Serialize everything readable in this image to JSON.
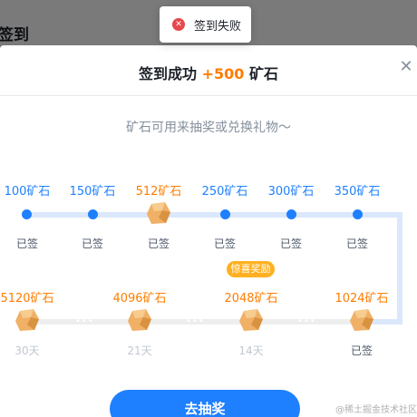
{
  "page": {
    "title": "签到"
  },
  "toast": {
    "icon": "error-icon",
    "text": "签到失败"
  },
  "modal": {
    "title_prefix": "签到成功",
    "title_bonus": "+500",
    "title_suffix": "矿石",
    "close_icon": "close-icon",
    "subtitle": "矿石可用来抽奖或兑换礼物～",
    "row1": [
      {
        "amount": "100矿石",
        "status": "已签",
        "reward": false
      },
      {
        "amount": "150矿石",
        "status": "已签",
        "reward": false
      },
      {
        "amount": "512矿石",
        "status": "已签",
        "reward": true
      },
      {
        "amount": "250矿石",
        "status": "已签",
        "reward": false
      },
      {
        "amount": "300矿石",
        "status": "已签",
        "reward": false
      },
      {
        "amount": "350矿石",
        "status": "已签",
        "reward": false
      }
    ],
    "row2": [
      {
        "amount": "5120矿石",
        "status": "30天",
        "reward": true
      },
      {
        "amount": "4096矿石",
        "status": "21天",
        "reward": true
      },
      {
        "amount": "2048矿石",
        "status": "14天",
        "reward": true,
        "badge": "惊喜奖励"
      },
      {
        "amount": "1024矿石",
        "status": "已签",
        "reward": true
      }
    ],
    "cta_label": "去抽奖"
  },
  "watermark": "@稀土掘金技术社区",
  "colors": {
    "accent": "#1e80ff",
    "bonus": "#ff7d00",
    "error": "#e5484d",
    "badge": "#ffb020"
  }
}
